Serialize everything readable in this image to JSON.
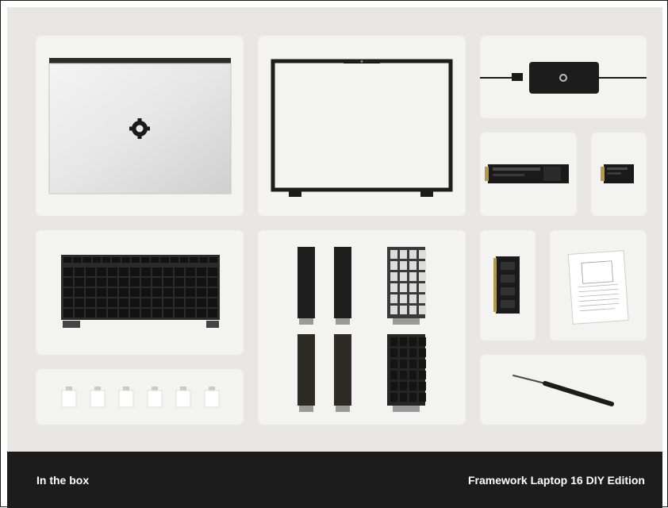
{
  "footer": {
    "left_label": "In the box",
    "right_label": "Framework Laptop 16 DIY Edition"
  },
  "colors": {
    "stage_background": "#e8e7e5",
    "tile_background": "#f3f3f2",
    "footer_background": "#1c1c1c",
    "footer_text": "#ffffff"
  },
  "items": [
    {
      "name": "laptop-lid",
      "icon": "framework-logo-icon"
    },
    {
      "name": "display-bezel",
      "icon": "bezel-icon"
    },
    {
      "name": "power-adapter",
      "icon": "power-adapter-icon"
    },
    {
      "name": "ssd-2280",
      "icon": "ssd-icon"
    },
    {
      "name": "ssd-2230",
      "icon": "ssd-small-icon"
    },
    {
      "name": "keyboard",
      "icon": "keyboard-icon"
    },
    {
      "name": "input-modules",
      "icon": "spacer-and-numpad-icon"
    },
    {
      "name": "memory-module",
      "icon": "ram-icon"
    },
    {
      "name": "quick-start-guide",
      "icon": "document-icon"
    },
    {
      "name": "expansion-cards",
      "icon": "expansion-card-icon"
    },
    {
      "name": "screwdriver",
      "icon": "screwdriver-icon"
    }
  ]
}
